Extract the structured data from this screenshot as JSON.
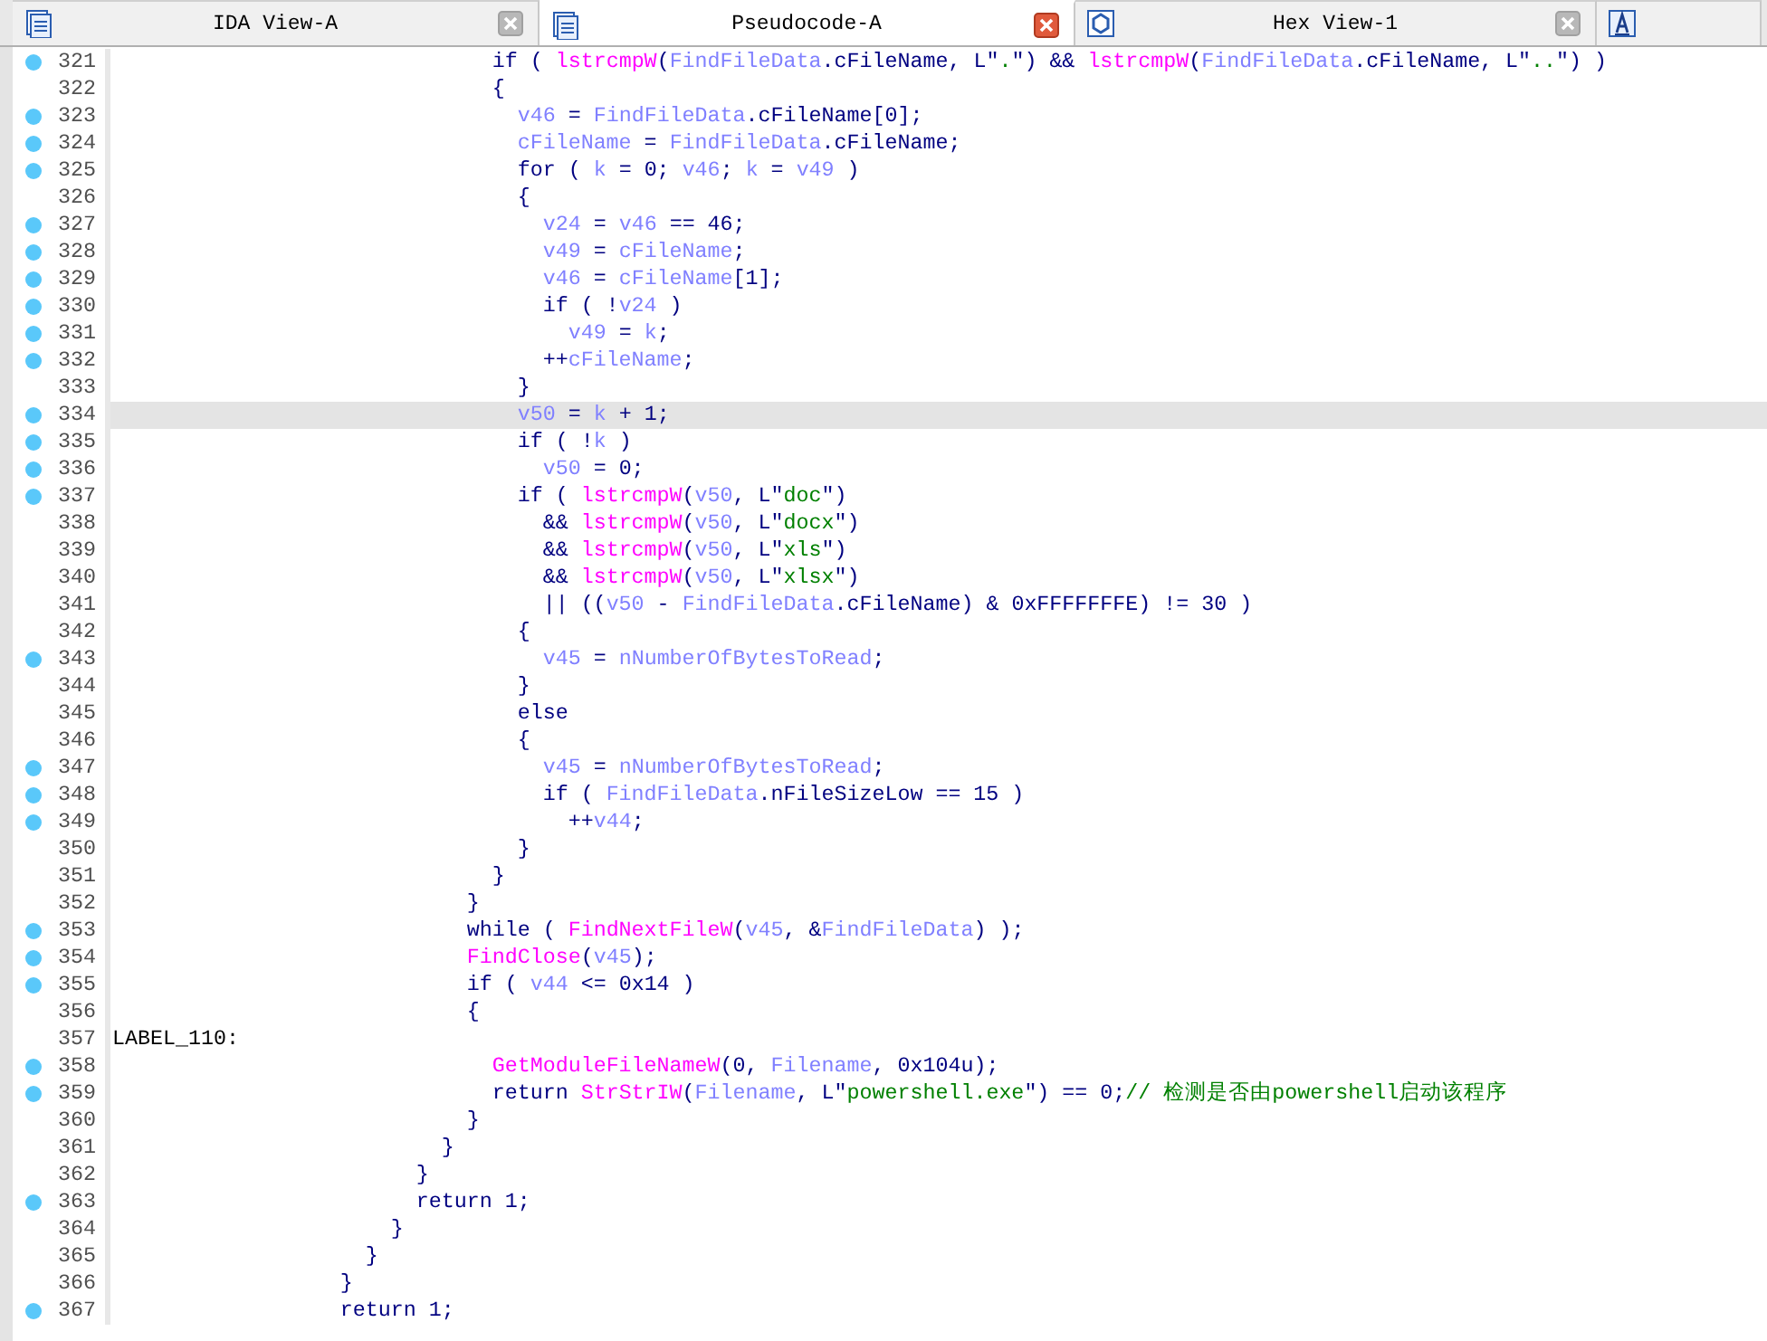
{
  "tabs": [
    {
      "kind": "disassembly",
      "label": "IDA View-A",
      "selected": false
    },
    {
      "kind": "pseudocode",
      "label": "Pseudocode-A",
      "selected": true
    },
    {
      "kind": "hex",
      "label": "Hex View-1",
      "selected": false
    },
    {
      "kind": "structures",
      "selected": false
    }
  ],
  "code": {
    "lines": [
      {
        "number": "321",
        "marker": true,
        "current": false,
        "tokens": [
          {
            "kind": "plain",
            "text": "                              if ( "
          },
          {
            "kind": "func",
            "text": "lstrcmpW"
          },
          {
            "kind": "plain",
            "text": "("
          },
          {
            "kind": "var",
            "text": "FindFileData"
          },
          {
            "kind": "plain",
            "text": ".cFileName, L\""
          },
          {
            "kind": "str",
            "text": "."
          },
          {
            "kind": "plain",
            "text": "\") && "
          },
          {
            "kind": "func",
            "text": "lstrcmpW"
          },
          {
            "kind": "plain",
            "text": "("
          },
          {
            "kind": "var",
            "text": "FindFileData"
          },
          {
            "kind": "plain",
            "text": ".cFileName, L\""
          },
          {
            "kind": "str",
            "text": ".."
          },
          {
            "kind": "plain",
            "text": "\") )"
          }
        ]
      },
      {
        "number": "322",
        "marker": false,
        "current": false,
        "tokens": [
          {
            "kind": "plain",
            "text": "                              {"
          }
        ]
      },
      {
        "number": "323",
        "marker": true,
        "current": false,
        "tokens": [
          {
            "kind": "var",
            "text": "                                v46"
          },
          {
            "kind": "plain",
            "text": " = "
          },
          {
            "kind": "var",
            "text": "FindFileData"
          },
          {
            "kind": "plain",
            "text": ".cFileName[0];"
          }
        ]
      },
      {
        "number": "324",
        "marker": true,
        "current": false,
        "tokens": [
          {
            "kind": "var",
            "text": "                                cFileName"
          },
          {
            "kind": "plain",
            "text": " = "
          },
          {
            "kind": "var",
            "text": "FindFileData"
          },
          {
            "kind": "plain",
            "text": ".cFileName;"
          }
        ]
      },
      {
        "number": "325",
        "marker": true,
        "current": false,
        "tokens": [
          {
            "kind": "plain",
            "text": "                                for ( "
          },
          {
            "kind": "var",
            "text": "k"
          },
          {
            "kind": "plain",
            "text": " = 0; "
          },
          {
            "kind": "var",
            "text": "v46"
          },
          {
            "kind": "plain",
            "text": "; "
          },
          {
            "kind": "var",
            "text": "k"
          },
          {
            "kind": "plain",
            "text": " = "
          },
          {
            "kind": "var",
            "text": "v49"
          },
          {
            "kind": "plain",
            "text": " )"
          }
        ]
      },
      {
        "number": "326",
        "marker": false,
        "current": false,
        "tokens": [
          {
            "kind": "plain",
            "text": "                                {"
          }
        ]
      },
      {
        "number": "327",
        "marker": true,
        "current": false,
        "tokens": [
          {
            "kind": "var",
            "text": "                                  v24"
          },
          {
            "kind": "plain",
            "text": " = "
          },
          {
            "kind": "var",
            "text": "v46"
          },
          {
            "kind": "plain",
            "text": " == 46;"
          }
        ]
      },
      {
        "number": "328",
        "marker": true,
        "current": false,
        "tokens": [
          {
            "kind": "var",
            "text": "                                  v49"
          },
          {
            "kind": "plain",
            "text": " = "
          },
          {
            "kind": "var",
            "text": "cFileName"
          },
          {
            "kind": "plain",
            "text": ";"
          }
        ]
      },
      {
        "number": "329",
        "marker": true,
        "current": false,
        "tokens": [
          {
            "kind": "var",
            "text": "                                  v46"
          },
          {
            "kind": "plain",
            "text": " = "
          },
          {
            "kind": "var",
            "text": "cFileName"
          },
          {
            "kind": "plain",
            "text": "[1];"
          }
        ]
      },
      {
        "number": "330",
        "marker": true,
        "current": false,
        "tokens": [
          {
            "kind": "plain",
            "text": "                                  if ( !"
          },
          {
            "kind": "var",
            "text": "v24"
          },
          {
            "kind": "plain",
            "text": " )"
          }
        ]
      },
      {
        "number": "331",
        "marker": true,
        "current": false,
        "tokens": [
          {
            "kind": "var",
            "text": "                                    v49"
          },
          {
            "kind": "plain",
            "text": " = "
          },
          {
            "kind": "var",
            "text": "k"
          },
          {
            "kind": "plain",
            "text": ";"
          }
        ]
      },
      {
        "number": "332",
        "marker": true,
        "current": false,
        "tokens": [
          {
            "kind": "plain",
            "text": "                                  ++"
          },
          {
            "kind": "var",
            "text": "cFileName"
          },
          {
            "kind": "plain",
            "text": ";"
          }
        ]
      },
      {
        "number": "333",
        "marker": false,
        "current": false,
        "tokens": [
          {
            "kind": "plain",
            "text": "                                }"
          }
        ]
      },
      {
        "number": "334",
        "marker": true,
        "current": true,
        "tokens": [
          {
            "kind": "var",
            "text": "                                v50"
          },
          {
            "kind": "plain",
            "text": " = "
          },
          {
            "kind": "var",
            "text": "k"
          },
          {
            "kind": "plain",
            "text": " + 1;"
          }
        ]
      },
      {
        "number": "335",
        "marker": true,
        "current": false,
        "tokens": [
          {
            "kind": "plain",
            "text": "                                if ( !"
          },
          {
            "kind": "var",
            "text": "k"
          },
          {
            "kind": "plain",
            "text": " )"
          }
        ]
      },
      {
        "number": "336",
        "marker": true,
        "current": false,
        "tokens": [
          {
            "kind": "var",
            "text": "                                  v50"
          },
          {
            "kind": "plain",
            "text": " = 0;"
          }
        ]
      },
      {
        "number": "337",
        "marker": true,
        "current": false,
        "tokens": [
          {
            "kind": "plain",
            "text": "                                if ( "
          },
          {
            "kind": "func",
            "text": "lstrcmpW"
          },
          {
            "kind": "plain",
            "text": "("
          },
          {
            "kind": "var",
            "text": "v50"
          },
          {
            "kind": "plain",
            "text": ", L\""
          },
          {
            "kind": "str",
            "text": "doc"
          },
          {
            "kind": "plain",
            "text": "\")"
          }
        ]
      },
      {
        "number": "338",
        "marker": false,
        "current": false,
        "tokens": [
          {
            "kind": "plain",
            "text": "                                  && "
          },
          {
            "kind": "func",
            "text": "lstrcmpW"
          },
          {
            "kind": "plain",
            "text": "("
          },
          {
            "kind": "var",
            "text": "v50"
          },
          {
            "kind": "plain",
            "text": ", L\""
          },
          {
            "kind": "str",
            "text": "docx"
          },
          {
            "kind": "plain",
            "text": "\")"
          }
        ]
      },
      {
        "number": "339",
        "marker": false,
        "current": false,
        "tokens": [
          {
            "kind": "plain",
            "text": "                                  && "
          },
          {
            "kind": "func",
            "text": "lstrcmpW"
          },
          {
            "kind": "plain",
            "text": "("
          },
          {
            "kind": "var",
            "text": "v50"
          },
          {
            "kind": "plain",
            "text": ", L\""
          },
          {
            "kind": "str",
            "text": "xls"
          },
          {
            "kind": "plain",
            "text": "\")"
          }
        ]
      },
      {
        "number": "340",
        "marker": false,
        "current": false,
        "tokens": [
          {
            "kind": "plain",
            "text": "                                  && "
          },
          {
            "kind": "func",
            "text": "lstrcmpW"
          },
          {
            "kind": "plain",
            "text": "("
          },
          {
            "kind": "var",
            "text": "v50"
          },
          {
            "kind": "plain",
            "text": ", L\""
          },
          {
            "kind": "str",
            "text": "xlsx"
          },
          {
            "kind": "plain",
            "text": "\")"
          }
        ]
      },
      {
        "number": "341",
        "marker": false,
        "current": false,
        "tokens": [
          {
            "kind": "plain",
            "text": "                                  || (("
          },
          {
            "kind": "var",
            "text": "v50"
          },
          {
            "kind": "plain",
            "text": " - "
          },
          {
            "kind": "var",
            "text": "FindFileData"
          },
          {
            "kind": "plain",
            "text": ".cFileName) & 0xFFFFFFFE) != 30 )"
          }
        ]
      },
      {
        "number": "342",
        "marker": false,
        "current": false,
        "tokens": [
          {
            "kind": "plain",
            "text": "                                {"
          }
        ]
      },
      {
        "number": "343",
        "marker": true,
        "current": false,
        "tokens": [
          {
            "kind": "var",
            "text": "                                  v45"
          },
          {
            "kind": "plain",
            "text": " = "
          },
          {
            "kind": "var",
            "text": "nNumberOfBytesToRead"
          },
          {
            "kind": "plain",
            "text": ";"
          }
        ]
      },
      {
        "number": "344",
        "marker": false,
        "current": false,
        "tokens": [
          {
            "kind": "plain",
            "text": "                                }"
          }
        ]
      },
      {
        "number": "345",
        "marker": false,
        "current": false,
        "tokens": [
          {
            "kind": "plain",
            "text": "                                else"
          }
        ]
      },
      {
        "number": "346",
        "marker": false,
        "current": false,
        "tokens": [
          {
            "kind": "plain",
            "text": "                                {"
          }
        ]
      },
      {
        "number": "347",
        "marker": true,
        "current": false,
        "tokens": [
          {
            "kind": "var",
            "text": "                                  v45"
          },
          {
            "kind": "plain",
            "text": " = "
          },
          {
            "kind": "var",
            "text": "nNumberOfBytesToRead"
          },
          {
            "kind": "plain",
            "text": ";"
          }
        ]
      },
      {
        "number": "348",
        "marker": true,
        "current": false,
        "tokens": [
          {
            "kind": "plain",
            "text": "                                  if ( "
          },
          {
            "kind": "var",
            "text": "FindFileData"
          },
          {
            "kind": "plain",
            "text": ".nFileSizeLow == 15 )"
          }
        ]
      },
      {
        "number": "349",
        "marker": true,
        "current": false,
        "tokens": [
          {
            "kind": "plain",
            "text": "                                    ++"
          },
          {
            "kind": "var",
            "text": "v44"
          },
          {
            "kind": "plain",
            "text": ";"
          }
        ]
      },
      {
        "number": "350",
        "marker": false,
        "current": false,
        "tokens": [
          {
            "kind": "plain",
            "text": "                                }"
          }
        ]
      },
      {
        "number": "351",
        "marker": false,
        "current": false,
        "tokens": [
          {
            "kind": "plain",
            "text": "                              }"
          }
        ]
      },
      {
        "number": "352",
        "marker": false,
        "current": false,
        "tokens": [
          {
            "kind": "plain",
            "text": "                            }"
          }
        ]
      },
      {
        "number": "353",
        "marker": true,
        "current": false,
        "tokens": [
          {
            "kind": "plain",
            "text": "                            while ( "
          },
          {
            "kind": "func",
            "text": "FindNextFileW"
          },
          {
            "kind": "plain",
            "text": "("
          },
          {
            "kind": "var",
            "text": "v45"
          },
          {
            "kind": "plain",
            "text": ", &"
          },
          {
            "kind": "var",
            "text": "FindFileData"
          },
          {
            "kind": "plain",
            "text": ") );"
          }
        ]
      },
      {
        "number": "354",
        "marker": true,
        "current": false,
        "tokens": [
          {
            "kind": "func",
            "text": "                            FindClose"
          },
          {
            "kind": "plain",
            "text": "("
          },
          {
            "kind": "var",
            "text": "v45"
          },
          {
            "kind": "plain",
            "text": ");"
          }
        ]
      },
      {
        "number": "355",
        "marker": true,
        "current": false,
        "tokens": [
          {
            "kind": "plain",
            "text": "                            if ( "
          },
          {
            "kind": "var",
            "text": "v44"
          },
          {
            "kind": "plain",
            "text": " <= 0x14 )"
          }
        ]
      },
      {
        "number": "356",
        "marker": false,
        "current": false,
        "tokens": [
          {
            "kind": "plain",
            "text": "                            {"
          }
        ]
      },
      {
        "number": "357",
        "marker": false,
        "current": false,
        "tokens": [
          {
            "kind": "label",
            "text": "LABEL_110:"
          }
        ]
      },
      {
        "number": "358",
        "marker": true,
        "current": false,
        "tokens": [
          {
            "kind": "func",
            "text": "                              GetModuleFileNameW"
          },
          {
            "kind": "plain",
            "text": "(0, "
          },
          {
            "kind": "var",
            "text": "Filename"
          },
          {
            "kind": "plain",
            "text": ", 0x104u);"
          }
        ]
      },
      {
        "number": "359",
        "marker": true,
        "current": false,
        "tokens": [
          {
            "kind": "plain",
            "text": "                              return "
          },
          {
            "kind": "func",
            "text": "StrStrIW"
          },
          {
            "kind": "plain",
            "text": "("
          },
          {
            "kind": "var",
            "text": "Filename"
          },
          {
            "kind": "plain",
            "text": ", L\""
          },
          {
            "kind": "str",
            "text": "powershell.exe"
          },
          {
            "kind": "plain",
            "text": "\") == 0;"
          },
          {
            "kind": "comment",
            "text": "// 检测是否由powershell启动该程序"
          }
        ]
      },
      {
        "number": "360",
        "marker": false,
        "current": false,
        "tokens": [
          {
            "kind": "plain",
            "text": "                            }"
          }
        ]
      },
      {
        "number": "361",
        "marker": false,
        "current": false,
        "tokens": [
          {
            "kind": "plain",
            "text": "                          }"
          }
        ]
      },
      {
        "number": "362",
        "marker": false,
        "current": false,
        "tokens": [
          {
            "kind": "plain",
            "text": "                        }"
          }
        ]
      },
      {
        "number": "363",
        "marker": true,
        "current": false,
        "tokens": [
          {
            "kind": "plain",
            "text": "                        return 1;"
          }
        ]
      },
      {
        "number": "364",
        "marker": false,
        "current": false,
        "tokens": [
          {
            "kind": "plain",
            "text": "                      }"
          }
        ]
      },
      {
        "number": "365",
        "marker": false,
        "current": false,
        "tokens": [
          {
            "kind": "plain",
            "text": "                    }"
          }
        ]
      },
      {
        "number": "366",
        "marker": false,
        "current": false,
        "tokens": [
          {
            "kind": "plain",
            "text": "                  }"
          }
        ]
      },
      {
        "number": "367",
        "marker": true,
        "current": false,
        "tokens": [
          {
            "kind": "plain",
            "text": "                  return 1;"
          }
        ]
      }
    ]
  }
}
